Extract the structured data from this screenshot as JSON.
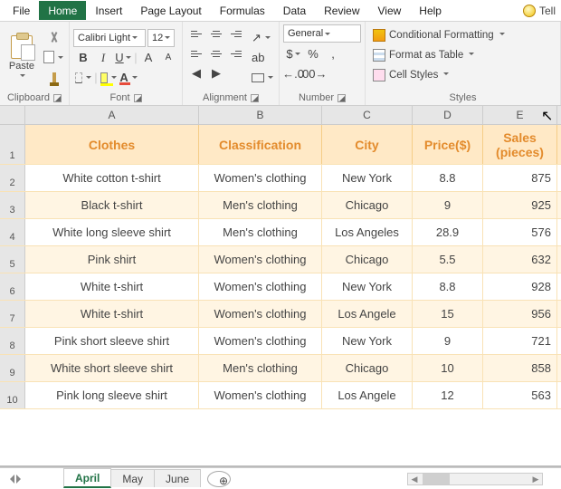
{
  "tabs": {
    "items": [
      "File",
      "Home",
      "Insert",
      "Page Layout",
      "Formulas",
      "Data",
      "Review",
      "View",
      "Help"
    ],
    "active": "Home",
    "tell": "Tell"
  },
  "ribbon": {
    "clipboard": {
      "label": "Clipboard",
      "paste": "Paste"
    },
    "font": {
      "label": "Font",
      "name": "Calibri Light",
      "size": "12",
      "bold": "B",
      "italic": "I",
      "underline": "U",
      "grow": "A",
      "shrink": "A",
      "fontcolor": "A"
    },
    "alignment": {
      "label": "Alignment",
      "wrap": "ab"
    },
    "number": {
      "label": "Number",
      "format": "General",
      "currency": "$",
      "percent": "%",
      "comma": ",",
      "incdec": ".0",
      "decdec": ".00"
    },
    "styles": {
      "label": "Styles",
      "conditional": "Conditional Formatting",
      "table": "Format as Table",
      "cell": "Cell Styles"
    }
  },
  "columns": [
    "A",
    "B",
    "C",
    "D",
    "E"
  ],
  "chart_data": {
    "type": "table",
    "headers": [
      "Clothes",
      "Classification",
      "City",
      "Price($)",
      "Sales (pieces)"
    ],
    "rows": [
      [
        "White cotton t-shirt",
        "Women's clothing",
        "New York",
        "8.8",
        "875"
      ],
      [
        "Black t-shirt",
        "Men's clothing",
        "Chicago",
        "9",
        "925"
      ],
      [
        "White long sleeve shirt",
        "Men's clothing",
        "Los Angeles",
        "28.9",
        "576"
      ],
      [
        "Pink shirt",
        "Women's clothing",
        "Chicago",
        "5.5",
        "632"
      ],
      [
        "White t-shirt",
        "Women's clothing",
        "New York",
        "8.8",
        "928"
      ],
      [
        "White t-shirt",
        "Women's clothing",
        "Los Angele",
        "15",
        "956"
      ],
      [
        "Pink short sleeve shirt",
        "Women's clothing",
        "New York",
        "9",
        "721"
      ],
      [
        "White short sleeve shirt",
        "Men's clothing",
        "Chicago",
        "10",
        "858"
      ],
      [
        "Pink long sleeve shirt",
        "Women's clothing",
        "Los Angele",
        "12",
        "563"
      ]
    ]
  },
  "sheets": {
    "tabs": [
      "April",
      "May",
      "June"
    ],
    "active": "April"
  }
}
